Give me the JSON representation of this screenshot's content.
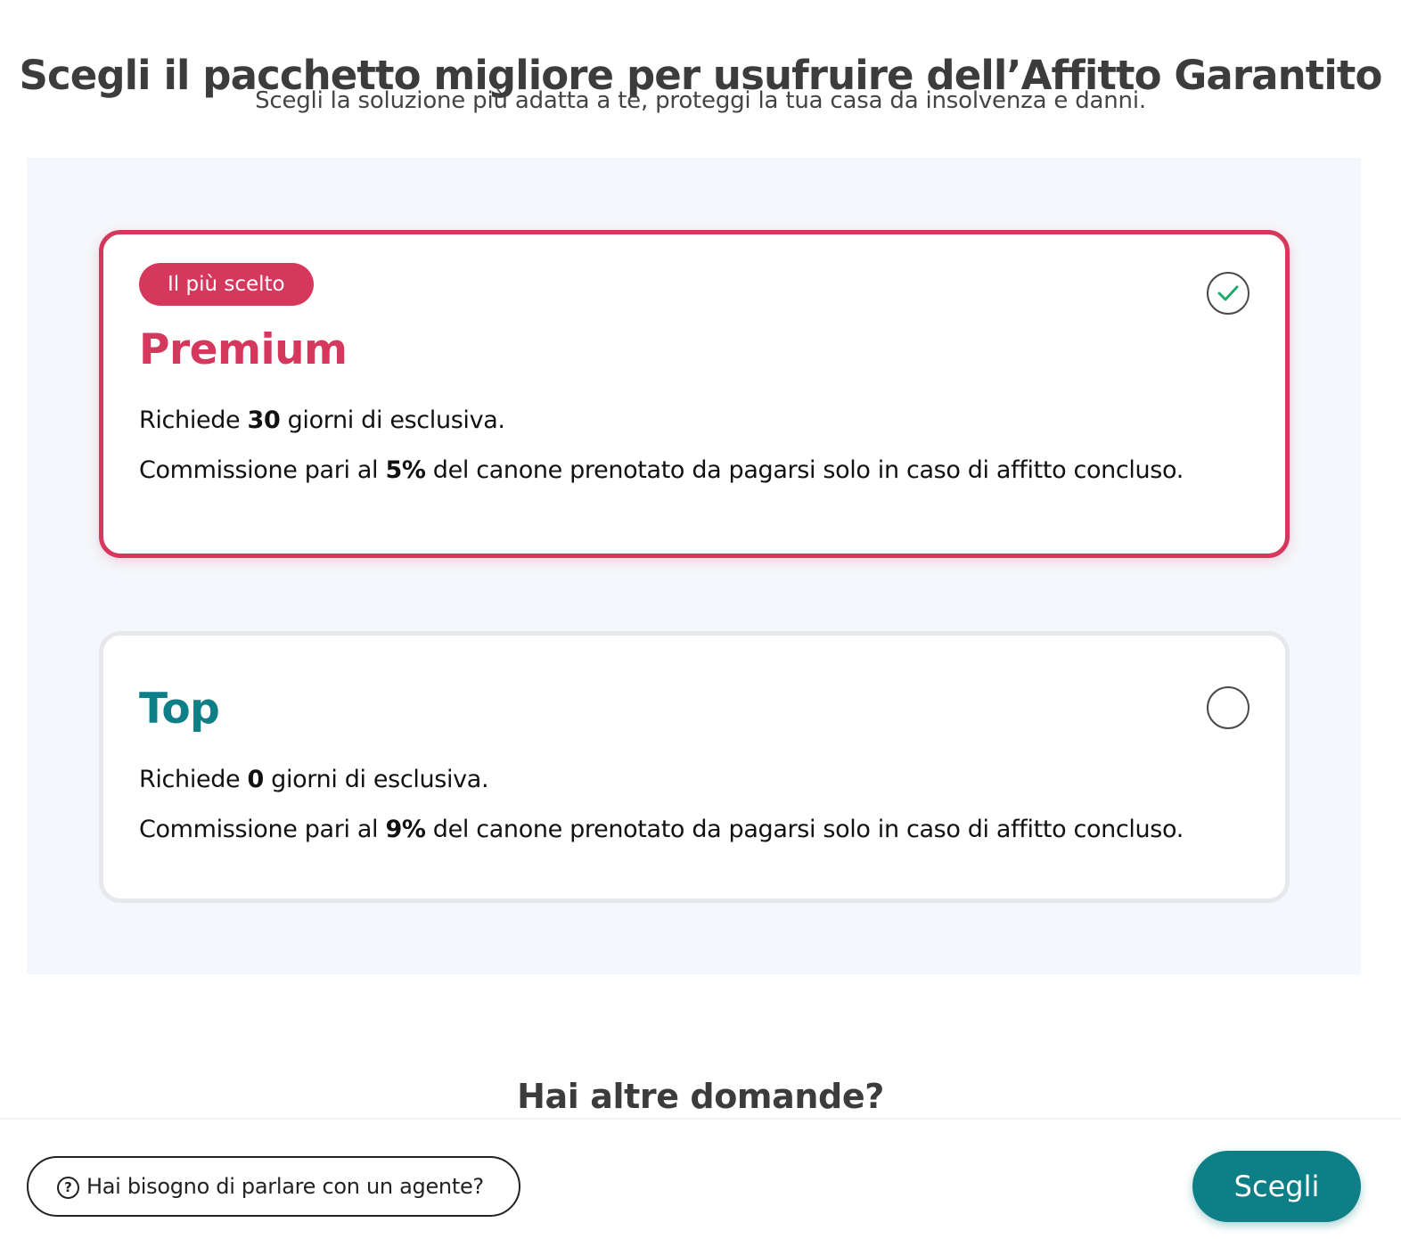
{
  "header": {
    "title": "Scegli il pacchetto migliore per usufruire dell’Affitto Garantito",
    "subtitle": "Scegli la soluzione più adatta a te, proteggi la tua casa da insolvenza e danni."
  },
  "plans": [
    {
      "badge": "Il più scelto",
      "name": "Premium",
      "selected": true,
      "exclusivity_prefix": "Richiede ",
      "exclusivity_days": "30",
      "exclusivity_suffix": " giorni di esclusiva.",
      "commission_prefix": "Commissione pari al ",
      "commission_value": "5%",
      "commission_suffix": " del canone prenotato da pagarsi solo in caso di affitto concluso."
    },
    {
      "name": "Top",
      "selected": false,
      "exclusivity_prefix": "Richiede ",
      "exclusivity_days": "0",
      "exclusivity_suffix": " giorni di esclusiva.",
      "commission_prefix": "Commissione pari al ",
      "commission_value": "9%",
      "commission_suffix": " del canone prenotato da pagarsi solo in caso di affitto concluso."
    }
  ],
  "faq": {
    "title": "Hai altre domande?"
  },
  "footer": {
    "agent_icon": "question-circle-icon",
    "agent_icon_glyph": "?",
    "agent_label": "Hai bisogno di parlare con un agente?",
    "choose_label": "Scegli"
  },
  "colors": {
    "premium_accent": "#d6385d",
    "top_accent": "#0e7f86",
    "check_color": "#1faa6b",
    "panel_background": "#f4f7fb"
  }
}
